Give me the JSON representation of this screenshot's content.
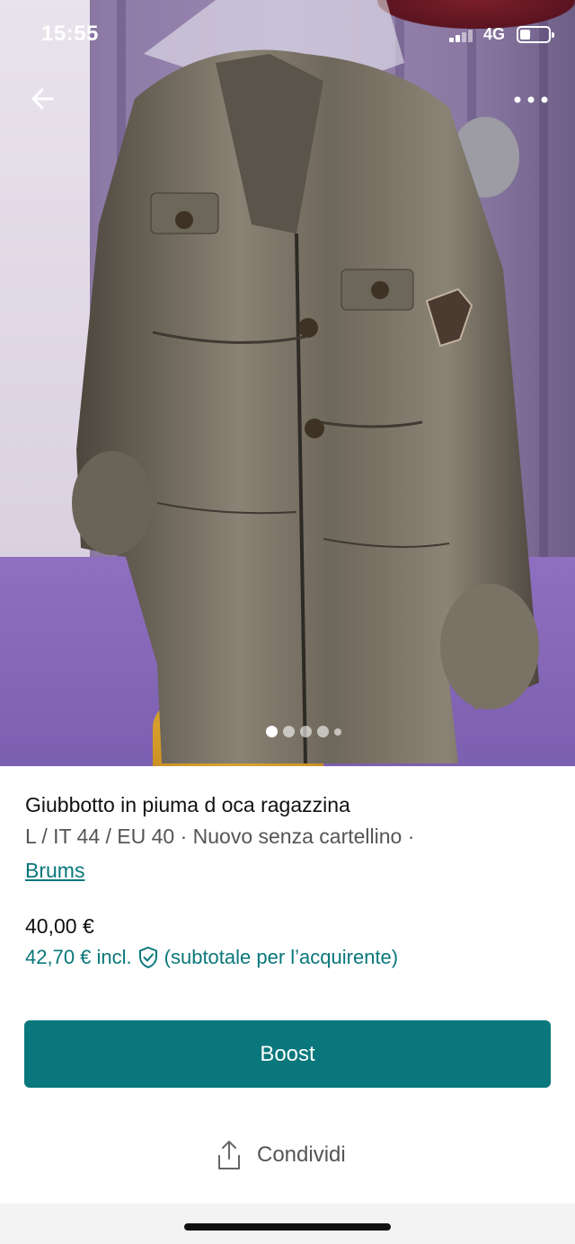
{
  "status_bar": {
    "time": "15:55",
    "network": "4G",
    "battery_level": 0.35
  },
  "gallery": {
    "photo_count": 5,
    "current_index": 1
  },
  "item": {
    "title": "Giubbotto in piuma d oca ragazzina",
    "details": "L / IT 44 / EU 40 · Nuovo senza cartellino ·",
    "brand": "Brums",
    "price": "40,00 €",
    "price_incl": "42,70 € incl.",
    "price_note": "(subtotale per l’acquirente)"
  },
  "actions": {
    "boost_label": "Boost",
    "share_label": "Condividi"
  },
  "colors": {
    "accent": "#09777b",
    "status_text": "#ffffff"
  },
  "icons": {
    "back": "arrow-left-icon",
    "more": "more-horizontal-icon",
    "shield": "shield-check-icon",
    "share": "share-icon"
  }
}
